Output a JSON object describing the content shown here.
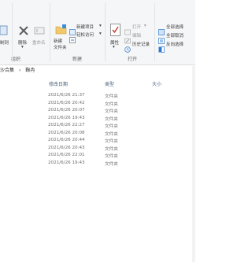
{
  "ribbon": {
    "clipboard_group": {
      "copy_path_label": "制到",
      "label": "组织"
    },
    "organize": {
      "delete_label": "删除",
      "rename_label": "重命名"
    },
    "new_group": {
      "new_item_label": "新建项目",
      "easy_access_label": "轻松访问",
      "new_folder_label": "新建\n文件夹",
      "label": "新建"
    },
    "open_group": {
      "properties_label": "属性",
      "open_label": "打开",
      "edit_label": "编辑",
      "history_label": "历史记录",
      "label": "打开"
    },
    "select_group": {
      "select_all_label": "全部选择",
      "select_none_label": "全部取消",
      "invert_label": "反向选择"
    }
  },
  "breadcrumb": {
    "parent": "沙合集",
    "separator": "›",
    "current": "鞠冉"
  },
  "columns": {
    "date": "修改日期",
    "type": "类型",
    "size": "大小"
  },
  "rows": [
    {
      "date": "2021/6/26 21:37",
      "type": "文件夹"
    },
    {
      "date": "2021/6/26 20:42",
      "type": "文件夹"
    },
    {
      "date": "2021/6/26 20:07",
      "type": "文件夹"
    },
    {
      "date": "2021/6/26 19:43",
      "type": "文件夹"
    },
    {
      "date": "2021/6/26 22:27",
      "type": "文件夹"
    },
    {
      "date": "2021/6/26 20:08",
      "type": "文件夹"
    },
    {
      "date": "2021/6/26 20:44",
      "type": "文件夹"
    },
    {
      "date": "2021/6/26 20:43",
      "type": "文件夹"
    },
    {
      "date": "2021/6/26 22:01",
      "type": "文件夹"
    },
    {
      "date": "2021/6/26 19:43",
      "type": "文件夹"
    }
  ],
  "colors": {
    "ribbon_bg": "#f5f6f7",
    "accent_blue": "#2f7ad0",
    "header_text": "#4c607a",
    "row_text": "#6d6d6d"
  }
}
